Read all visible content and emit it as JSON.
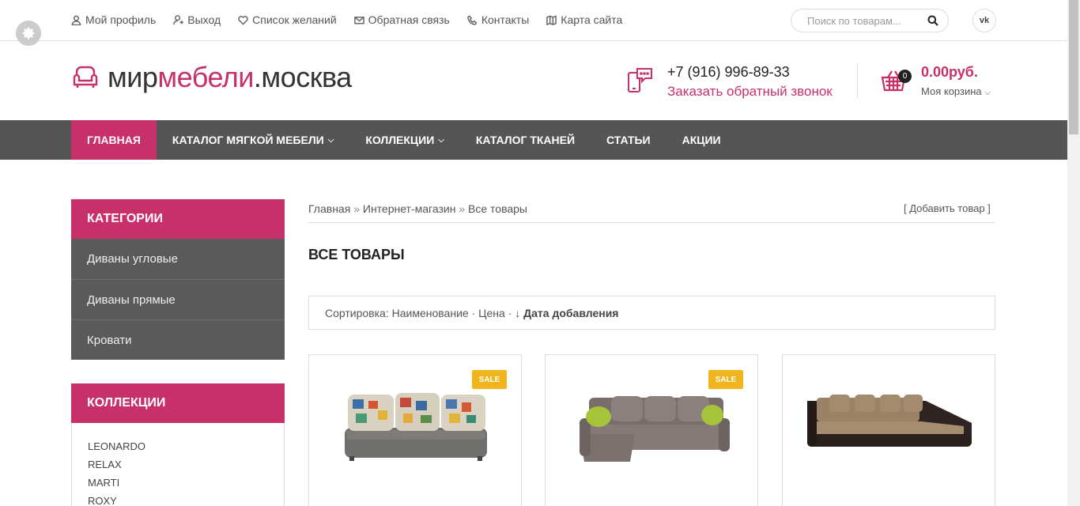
{
  "topbar": {
    "links": [
      {
        "label": "Мой профиль",
        "icon": "user-icon"
      },
      {
        "label": "Выход",
        "icon": "logout-icon"
      },
      {
        "label": "Список желаний",
        "icon": "heart-icon"
      },
      {
        "label": "Обратная связь",
        "icon": "envelope-icon"
      },
      {
        "label": "Контакты",
        "icon": "phone-icon"
      },
      {
        "label": "Карта сайта",
        "icon": "map-icon"
      }
    ],
    "search_placeholder": "Поиск по товарам...",
    "social": "vk"
  },
  "header": {
    "logo_part1": "мир",
    "logo_part2": "мебели",
    "logo_part3": ".москва",
    "phone": "+7 (916) 996-89-33",
    "callback": "Заказать обратный звонок",
    "cart_count": "0",
    "cart_total": "0.00руб.",
    "cart_label": "Моя корзина"
  },
  "nav": {
    "items": [
      {
        "label": "ГЛАВНАЯ",
        "active": true
      },
      {
        "label": "КАТАЛОГ МЯГКОЙ МЕБЕЛИ",
        "dropdown": true
      },
      {
        "label": "КОЛЛЕКЦИИ",
        "dropdown": true
      },
      {
        "label": "КАТАЛОГ ТКАНЕЙ"
      },
      {
        "label": "СТАТЬИ"
      },
      {
        "label": "АКЦИИ"
      }
    ]
  },
  "sidebar": {
    "categories_title": "КАТЕГОРИИ",
    "categories": [
      "Диваны угловые",
      "Диваны прямые",
      "Кровати"
    ],
    "collections_title": "КОЛЛЕКЦИИ",
    "collections": [
      "LEONARDO",
      "RELAX",
      "MARTI",
      "ROXY"
    ]
  },
  "main": {
    "breadcrumb": [
      "Главная",
      "Интернет-магазин",
      "Все товары"
    ],
    "breadcrumb_sep": "»",
    "add_item": "[ Добавить товар ]",
    "title": "ВСЕ ТОВАРЫ",
    "sort_label": "Сортировка:",
    "sort_options": [
      "Наименование",
      "Цена"
    ],
    "sort_current": "Дата добавления",
    "sort_arrow": "↓",
    "products": [
      {
        "badge": "SALE"
      },
      {
        "badge": "SALE"
      },
      {
        "badge": ""
      }
    ]
  },
  "colors": {
    "accent": "#c8306a",
    "nav_bg": "#555555",
    "sale": "#f0b41c"
  }
}
